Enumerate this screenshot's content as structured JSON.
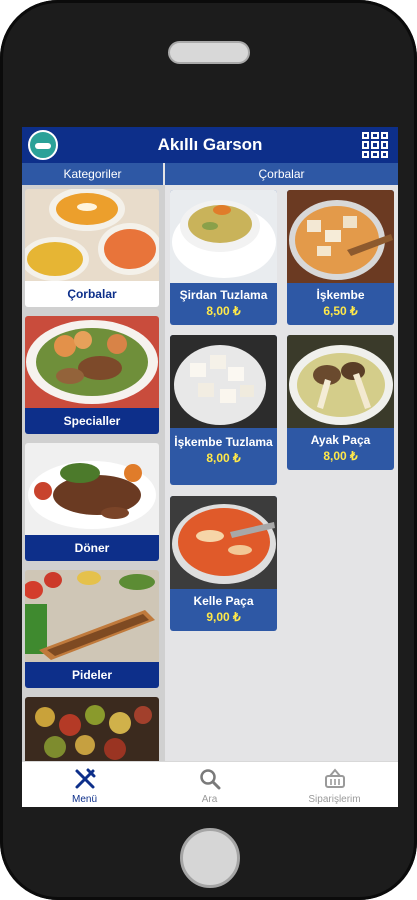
{
  "app": {
    "title": "Akıllı Garson"
  },
  "headers": {
    "categories": "Kategoriler",
    "current": "Çorbalar"
  },
  "categories": [
    {
      "label": "Çorbalar",
      "active": true
    },
    {
      "label": "Specialler",
      "active": false
    },
    {
      "label": "Döner",
      "active": false
    },
    {
      "label": "Pideler",
      "active": false
    },
    {
      "label": "",
      "active": false
    }
  ],
  "products": [
    {
      "name": "Şirdan Tuzlama",
      "price": "8,00 ₺"
    },
    {
      "name": "İşkembe",
      "price": "6,50 ₺"
    },
    {
      "name": "İşkembe Tuzlama",
      "price": "8,00 ₺"
    },
    {
      "name": "Ayak Paça",
      "price": "8,00 ₺"
    },
    {
      "name": "Kelle Paça",
      "price": "9,00 ₺"
    }
  ],
  "nav": {
    "menu": "Menü",
    "search": "Ara",
    "orders": "Siparişlerim"
  },
  "icons": {
    "logo": "car-logo-icon",
    "grid": "grid-icon",
    "menu": "fork-knife-icon",
    "search": "search-icon",
    "orders": "basket-icon"
  },
  "colors": {
    "primary": "#0d2f8a",
    "secondary": "#2e58a5",
    "price": "#ffe94a"
  }
}
